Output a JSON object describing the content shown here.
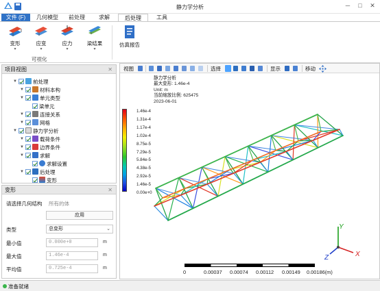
{
  "window": {
    "title": "静力学分析"
  },
  "tabs": [
    "文件 (F)",
    "几何模型",
    "前处理",
    "求解",
    "后处理",
    "工具"
  ],
  "ribbon": {
    "buttons": [
      "变形",
      "应变",
      "应力",
      "梁结果"
    ],
    "group_label": "可视化",
    "report_button": "仿真报告"
  },
  "project_view": {
    "title": "项目视图",
    "tree": [
      "前处理",
      "材料本构",
      "单元类型",
      "梁单元",
      "连接关系",
      "网格",
      "静力学分析",
      "载荷条件",
      "边界条件",
      "求解",
      "求解设置",
      "后处理",
      "变形"
    ]
  },
  "props": {
    "title": "变形",
    "select_geometry_label": "请选择几何结构",
    "select_geometry_value": "所有的体",
    "apply_button": "应用",
    "type_label": "类型",
    "type_value": "总变形",
    "min_label": "最小值",
    "min_value": "0.000e+0",
    "max_label": "最大值",
    "max_value": "1.46e-4",
    "avg_label": "平均值",
    "avg_value": "0.725e-4",
    "unit": "m"
  },
  "viewport": {
    "toolbar": {
      "view": "视图",
      "select": "选择",
      "display": "显示",
      "move": "移动"
    },
    "info": [
      "静力学分析",
      "最大变形: 1.46e-4",
      "Unit: m",
      "当前缩放比例: 625475",
      "2023-06-01"
    ],
    "legend": [
      "1.46e-4",
      "1.31e-4",
      "1.17e-4",
      "1.02e-4",
      "8.75e-5",
      "7.29e-5",
      "5.84e-5",
      "4.38e-5",
      "2.92e-5",
      "1.46e-5",
      "0.00e+0"
    ],
    "scale_labels": [
      "0",
      "0.00037",
      "0.00074",
      "0.00112",
      "0.00149",
      "0.00186(m)"
    ],
    "axes": {
      "x": "X",
      "y": "Y",
      "z": "Z"
    }
  },
  "status": {
    "text": "准备就绪"
  },
  "colors": {
    "accent": "#2f72c7",
    "status": "#39b54a"
  }
}
